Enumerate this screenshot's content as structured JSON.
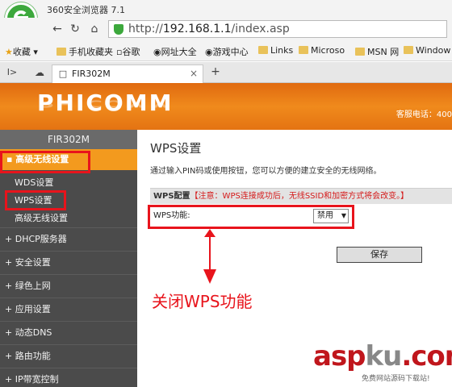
{
  "browser": {
    "title": "360安全浏览器 7.1",
    "url_prefix": "http://",
    "url_host": "192.168.1.1",
    "url_path": "/index.asp",
    "bookmarks": [
      "收藏",
      "手机收藏夹",
      "谷歌",
      "网址大全",
      "游戏中心",
      "Links",
      "Microso",
      "MSN 网",
      "Window"
    ],
    "tab_title": "FIR302M",
    "new_tab": "+"
  },
  "router": {
    "brand": "PHICOMM",
    "hotline": "客服电话：400",
    "model": "FIR302M",
    "menu": {
      "active": "高级无线设置",
      "subitems": [
        "WDS设置",
        "WPS设置",
        "高级无线设置"
      ],
      "items": [
        "DHCP服务器",
        "安全设置",
        "绿色上网",
        "应用设置",
        "动态DNS",
        "路由功能",
        "IP带宽控制"
      ]
    }
  },
  "page": {
    "title": "WPS设置",
    "description": "通过输入PIN码或使用按钮，您可以方便的建立安全的无线网络。",
    "config_label": "WPS配置",
    "warning": "【注意：WPS连接成功后，无线SSID和加密方式将会改变。】",
    "wps_label": "WPS功能:",
    "wps_value": "禁用",
    "save": "保存"
  },
  "annotation": "关闭WPS功能",
  "watermark": {
    "main1": "asp",
    "main2": "ku",
    "main3": ".com",
    "sub": "免费网站源码下载站!"
  }
}
